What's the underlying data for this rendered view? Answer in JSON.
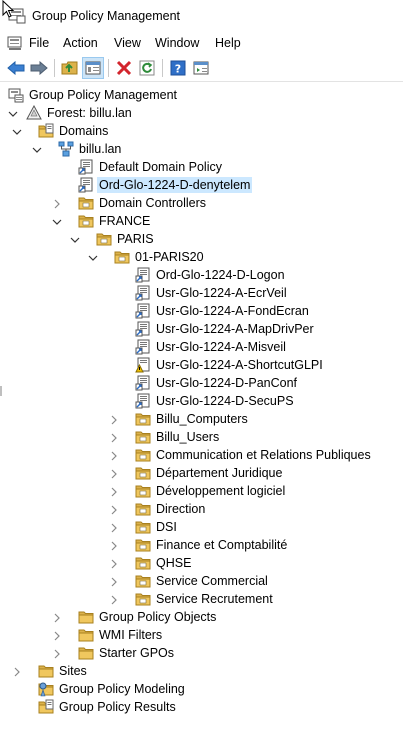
{
  "window": {
    "title": "Group Policy Management"
  },
  "menu": {
    "items": [
      "File",
      "Action",
      "View",
      "Window",
      "Help"
    ]
  },
  "colors": {
    "selection": "#cce8ff",
    "folder": "#dcb24b",
    "toolbar_active": "#cce4f7",
    "delete_red": "#d3252d"
  },
  "tree": {
    "root": "Group Policy Management",
    "forest": "Forest: billu.lan",
    "domains": "Domains",
    "domain": "billu.lan",
    "default_policy": "Default Domain Policy",
    "selected_gpo_link": "Ord-Glo-1224-D-denytelem",
    "domain_controllers": "Domain Controllers",
    "ou_france": "FRANCE",
    "ou_paris": "PARIS",
    "ou_paris20": "01-PARIS20",
    "gpo_links": [
      "Ord-Glo-1224-D-Logon",
      "Usr-Glo-1224-A-EcrVeil",
      "Usr-Glo-1224-A-FondEcran",
      "Usr-Glo-1224-A-MapDrivPer",
      "Usr-Glo-1224-A-Misveil",
      "Usr-Glo-1224-A-ShortcutGLPI",
      "Usr-Glo-1224-D-PanConf",
      "Usr-Glo-1224-D-SecuPS"
    ],
    "sub_ous": [
      "Billu_Computers",
      "Billu_Users",
      "Communication et Relations Publiques",
      "Département Juridique",
      "Développement logiciel",
      "Direction",
      "DSI",
      "Finance et Comptabilité",
      "QHSE",
      "Service Commercial",
      "Service Recrutement"
    ],
    "gpo_objects": "Group Policy Objects",
    "wmi_filters": "WMI Filters",
    "starter_gpos": "Starter GPOs",
    "sites": "Sites",
    "modeling": "Group Policy Modeling",
    "results": "Group Policy Results"
  }
}
